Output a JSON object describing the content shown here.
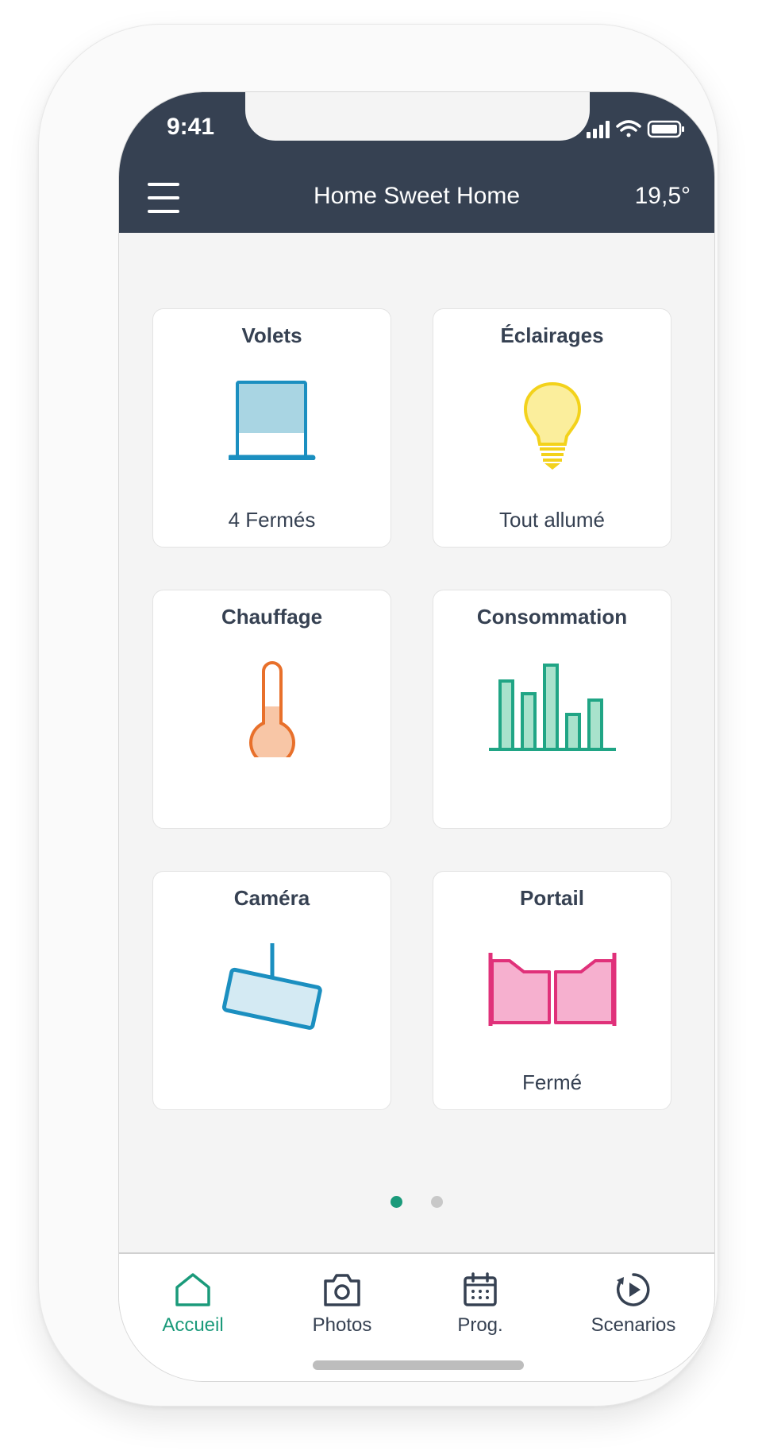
{
  "status_bar": {
    "time": "9:41"
  },
  "header": {
    "title": "Home Sweet Home",
    "temperature": "19,5°"
  },
  "cards": [
    {
      "title": "Volets",
      "status": "4 Fermés",
      "icon": "shutter-icon",
      "color": "#1b8fc0"
    },
    {
      "title": "Éclairages",
      "status": "Tout allumé",
      "icon": "lightbulb-icon",
      "color": "#f3d21b"
    },
    {
      "title": "Chauffage",
      "status": "",
      "icon": "thermometer-icon",
      "color": "#e8702b"
    },
    {
      "title": "Consommation",
      "status": "",
      "icon": "bar-chart-icon",
      "color": "#20a585"
    },
    {
      "title": "Caméra",
      "status": "",
      "icon": "camera-icon",
      "color": "#1b8fc0"
    },
    {
      "title": "Portail",
      "status": "Fermé",
      "icon": "gate-icon",
      "color": "#e0317a"
    }
  ],
  "pagination": {
    "pages": 2,
    "active": 1
  },
  "tabs": [
    {
      "label": "Accueil",
      "icon": "home-icon",
      "active": true
    },
    {
      "label": "Photos",
      "icon": "camera-outline-icon",
      "active": false
    },
    {
      "label": "Prog.",
      "icon": "calendar-icon",
      "active": false
    },
    {
      "label": "Scenarios",
      "icon": "play-history-icon",
      "active": false
    }
  ],
  "colors": {
    "header_bg": "#364152",
    "accent": "#1a9a7a",
    "text": "#364152",
    "inactive_dot": "#c8c8c8"
  }
}
